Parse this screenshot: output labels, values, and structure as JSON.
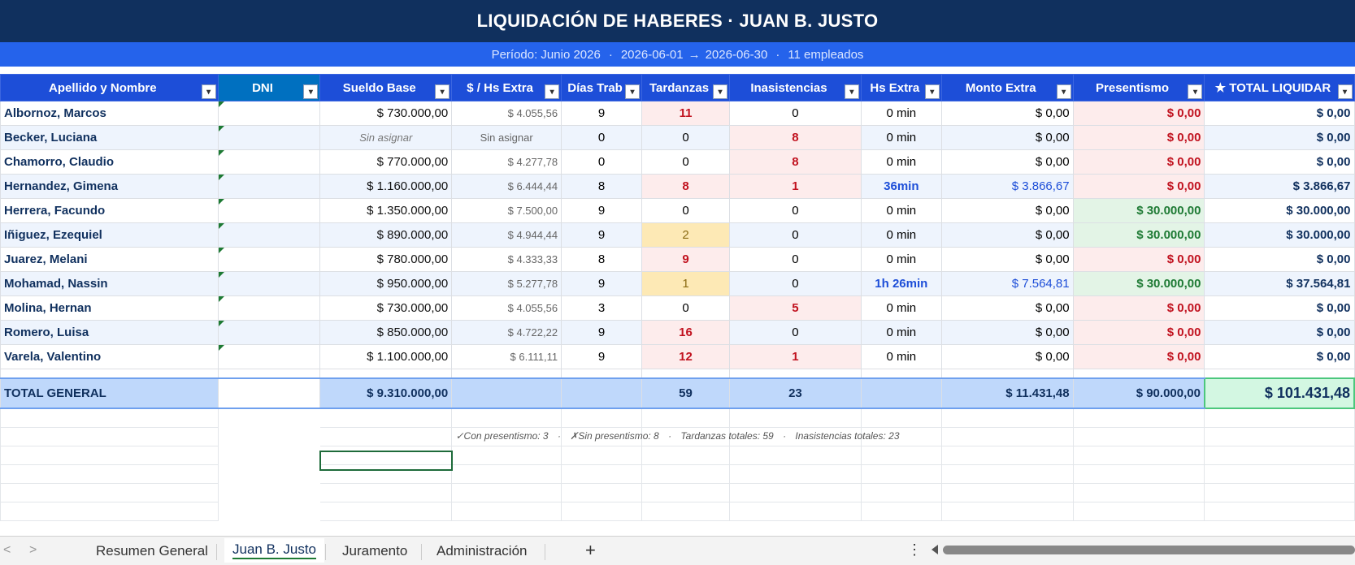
{
  "header": {
    "title": "LIQUIDACIÓN DE HABERES  ·  JUAN B. JUSTO",
    "periodo": "Período: Junio 2026",
    "fecha_inicio": "2026-06-01",
    "arrow": "→",
    "fecha_fin": "2026-06-30",
    "empleados": "11 empleados",
    "sep": "·"
  },
  "columns": [
    "Apellido y Nombre",
    "DNI",
    "Sueldo Base",
    "$ / Hs Extra",
    "Días Trab",
    "Tardanzas",
    "Inasistencias",
    "Hs Extra",
    "Monto Extra",
    "Presentismo",
    "★ TOTAL LIQUIDAR"
  ],
  "filter_icon": "▾",
  "rows": [
    {
      "nombre": "Albornoz, Marcos",
      "dni": "",
      "sueldo": "$ 730.000,00",
      "hs_extra_valor": "$ 4.055,56",
      "dias": "9",
      "tardanzas": "11",
      "inasistencias": "0",
      "hs_extra": "0 min",
      "monto_extra": "$ 0,00",
      "presentismo": "$ 0,00",
      "total": "$ 0,00"
    },
    {
      "nombre": "Becker, Luciana",
      "dni": "",
      "sueldo": "Sin asignar",
      "hs_extra_valor": "Sin asignar",
      "dias": "0",
      "tardanzas": "0",
      "inasistencias": "8",
      "hs_extra": "0 min",
      "monto_extra": "$ 0,00",
      "presentismo": "$ 0,00",
      "total": "$ 0,00"
    },
    {
      "nombre": "Chamorro, Claudio",
      "dni": "",
      "sueldo": "$ 770.000,00",
      "hs_extra_valor": "$ 4.277,78",
      "dias": "0",
      "tardanzas": "0",
      "inasistencias": "8",
      "hs_extra": "0 min",
      "monto_extra": "$ 0,00",
      "presentismo": "$ 0,00",
      "total": "$ 0,00"
    },
    {
      "nombre": "Hernandez, Gimena",
      "dni": "",
      "sueldo": "$ 1.160.000,00",
      "hs_extra_valor": "$ 6.444,44",
      "dias": "8",
      "tardanzas": "8",
      "inasistencias": "1",
      "hs_extra": "36min",
      "monto_extra": "$ 3.866,67",
      "presentismo": "$ 0,00",
      "total": "$ 3.866,67"
    },
    {
      "nombre": "Herrera, Facundo",
      "dni": "",
      "sueldo": "$ 1.350.000,00",
      "hs_extra_valor": "$ 7.500,00",
      "dias": "9",
      "tardanzas": "0",
      "inasistencias": "0",
      "hs_extra": "0 min",
      "monto_extra": "$ 0,00",
      "presentismo": "$ 30.000,00",
      "total": "$ 30.000,00"
    },
    {
      "nombre": "Iñiguez, Ezequiel",
      "dni": "",
      "sueldo": "$ 890.000,00",
      "hs_extra_valor": "$ 4.944,44",
      "dias": "9",
      "tardanzas": "2",
      "inasistencias": "0",
      "hs_extra": "0 min",
      "monto_extra": "$ 0,00",
      "presentismo": "$ 30.000,00",
      "total": "$ 30.000,00"
    },
    {
      "nombre": "Juarez, Melani",
      "dni": "",
      "sueldo": "$ 780.000,00",
      "hs_extra_valor": "$ 4.333,33",
      "dias": "8",
      "tardanzas": "9",
      "inasistencias": "0",
      "hs_extra": "0 min",
      "monto_extra": "$ 0,00",
      "presentismo": "$ 0,00",
      "total": "$ 0,00"
    },
    {
      "nombre": "Mohamad, Nassin",
      "dni": "",
      "sueldo": "$ 950.000,00",
      "hs_extra_valor": "$ 5.277,78",
      "dias": "9",
      "tardanzas": "1",
      "inasistencias": "0",
      "hs_extra": "1h 26min",
      "monto_extra": "$ 7.564,81",
      "presentismo": "$ 30.000,00",
      "total": "$ 37.564,81"
    },
    {
      "nombre": "Molina, Hernan",
      "dni": "",
      "sueldo": "$ 730.000,00",
      "hs_extra_valor": "$ 4.055,56",
      "dias": "3",
      "tardanzas": "0",
      "inasistencias": "5",
      "hs_extra": "0 min",
      "monto_extra": "$ 0,00",
      "presentismo": "$ 0,00",
      "total": "$ 0,00"
    },
    {
      "nombre": "Romero, Luisa",
      "dni": "",
      "sueldo": "$ 850.000,00",
      "hs_extra_valor": "$ 4.722,22",
      "dias": "9",
      "tardanzas": "16",
      "inasistencias": "0",
      "hs_extra": "0 min",
      "monto_extra": "$ 0,00",
      "presentismo": "$ 0,00",
      "total": "$ 0,00"
    },
    {
      "nombre": "Varela, Valentino",
      "dni": "",
      "sueldo": "$ 1.100.000,00",
      "hs_extra_valor": "$ 6.111,11",
      "dias": "9",
      "tardanzas": "12",
      "inasistencias": "1",
      "hs_extra": "0 min",
      "monto_extra": "$ 0,00",
      "presentismo": "$ 0,00",
      "total": "$ 0,00"
    }
  ],
  "totals": {
    "label": "TOTAL GENERAL",
    "sueldo": "$ 9.310.000,00",
    "tardanzas": "59",
    "inasistencias": "23",
    "monto_extra": "$ 11.431,48",
    "presentismo": "$ 90.000,00",
    "total": "$ 101.431,48"
  },
  "summary": {
    "con_presentismo": "✓Con presentismo: 3",
    "sin_presentismo": "✗Sin presentismo: 8",
    "tardanzas": "Tardanzas totales: 59",
    "inasistencias": "Inasistencias totales: 23",
    "sep": "·"
  },
  "tabs": [
    {
      "label": "Resumen General",
      "active": false
    },
    {
      "label": "Juan B. Justo",
      "active": true
    },
    {
      "label": "Juramento",
      "active": false
    },
    {
      "label": "Administración",
      "active": false
    }
  ],
  "tab_controls": {
    "prev": "<",
    "next": ">",
    "add": "+",
    "more": "⋮"
  },
  "colors": {
    "title_bg": "#10305e",
    "subtitle_bg": "#2563eb",
    "header_bg": "#1d4ed8",
    "red": "#c1121f",
    "green": "#1e7a34"
  }
}
